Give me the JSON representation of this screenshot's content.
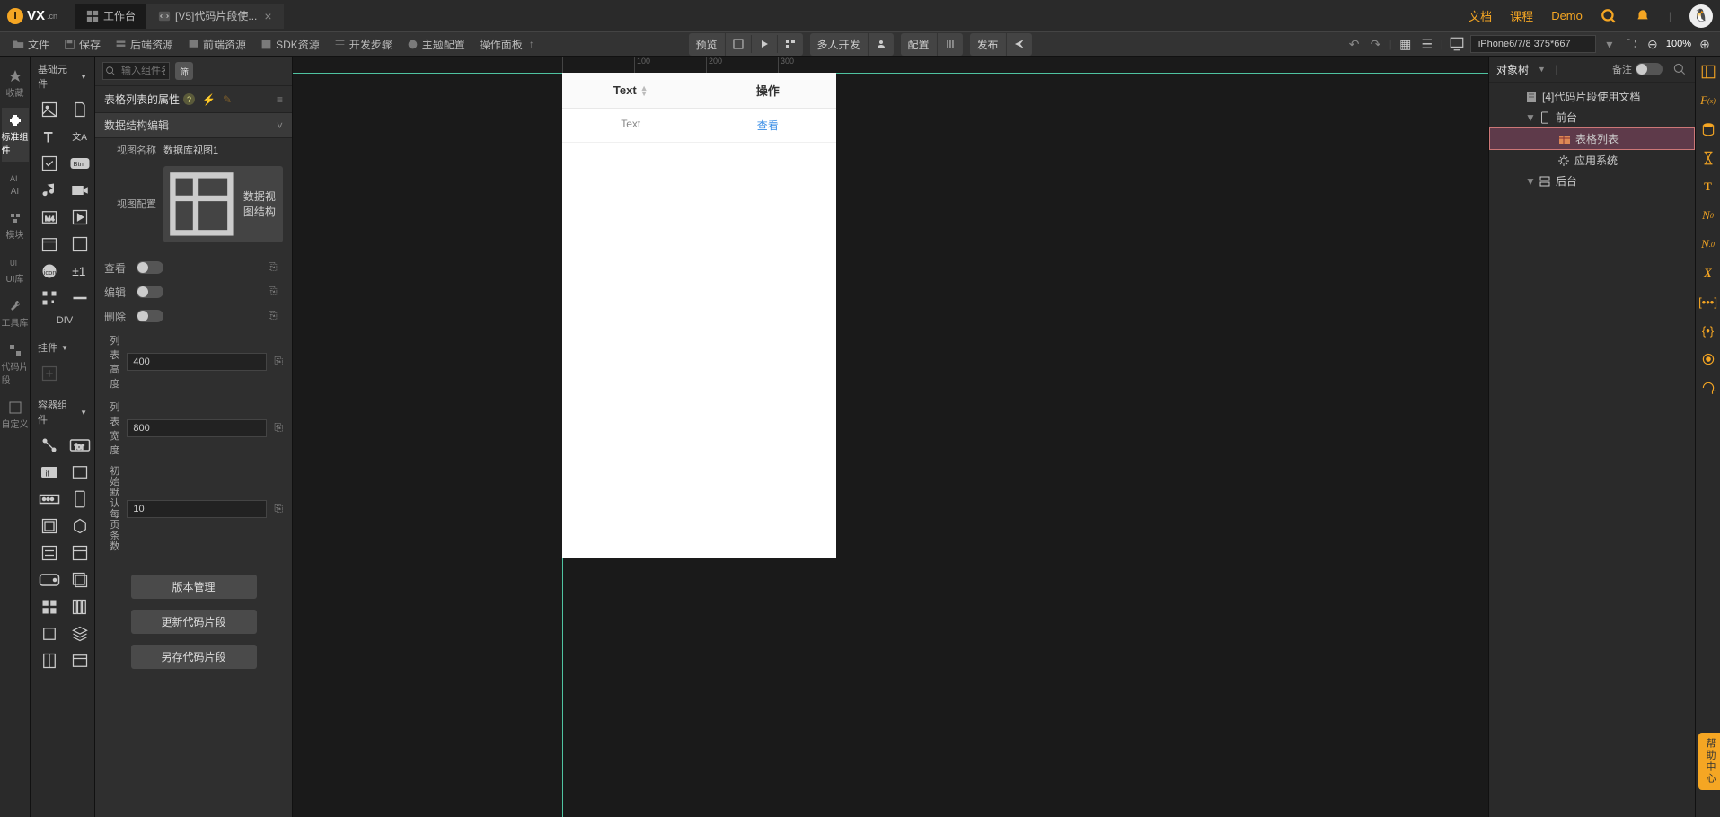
{
  "header": {
    "logo_text": "VX",
    "logo_suffix": ".cn",
    "tabs": [
      {
        "label": "工作台"
      },
      {
        "label": "[V5]代码片段使..."
      }
    ],
    "nav": [
      "文档",
      "课程",
      "Demo"
    ]
  },
  "menubar": {
    "left": [
      "文件",
      "保存",
      "后端资源",
      "前端资源",
      "SDK资源",
      "开发步骤",
      "主题配置",
      "操作面板"
    ],
    "center": {
      "preview": "预览",
      "multi": "多人开发",
      "config": "配置",
      "publish": "发布"
    },
    "device": "iPhone6/7/8 375*667",
    "zoom": "100%"
  },
  "left_rail": [
    {
      "label": "收藏"
    },
    {
      "label": "标准组件",
      "selected": true
    },
    {
      "label": "AI"
    },
    {
      "label": "模块"
    },
    {
      "label": "UI库"
    },
    {
      "label": "工具库"
    },
    {
      "label": "代码片段"
    },
    {
      "label": "自定义"
    }
  ],
  "palette": {
    "section1": "基础元件",
    "div_label": "DIV",
    "section2": "挂件",
    "section3": "容器组件"
  },
  "props": {
    "search_placeholder": "输入组件名称",
    "title": "表格列表的属性",
    "section": "数据结构编辑",
    "view_name_label": "视图名称",
    "view_name_value": "数据库视图1",
    "view_config_label": "视图配置",
    "view_config_btn": "数据视图结构",
    "toggles": {
      "view": "查看",
      "edit": "编辑",
      "delete": "删除"
    },
    "list_height_label": "列表高度",
    "list_height": "400",
    "list_width_label": "列表宽度",
    "list_width": "800",
    "page_size_label": "初始默认每页条数",
    "page_size": "10",
    "btn_version": "版本管理",
    "btn_update": "更新代码片段",
    "btn_saveas": "另存代码片段"
  },
  "canvas": {
    "ruler": [
      "100",
      "200",
      "300"
    ],
    "table": {
      "headers": [
        "Text",
        "操作"
      ],
      "row": [
        "Text",
        "查看"
      ]
    }
  },
  "tree": {
    "title": "对象树",
    "remark_label": "备注",
    "items": [
      {
        "indent": 1,
        "icon": "doc",
        "label": "[4]代码片段使用文档"
      },
      {
        "indent": 1,
        "icon": "phone",
        "label": "前台",
        "caret": true
      },
      {
        "indent": 2,
        "icon": "table",
        "label": "表格列表",
        "selected": true
      },
      {
        "indent": 2,
        "icon": "gear",
        "label": "应用系统"
      },
      {
        "indent": 1,
        "icon": "server",
        "label": "后台",
        "caret": true
      }
    ]
  },
  "help_float": "帮助中心"
}
